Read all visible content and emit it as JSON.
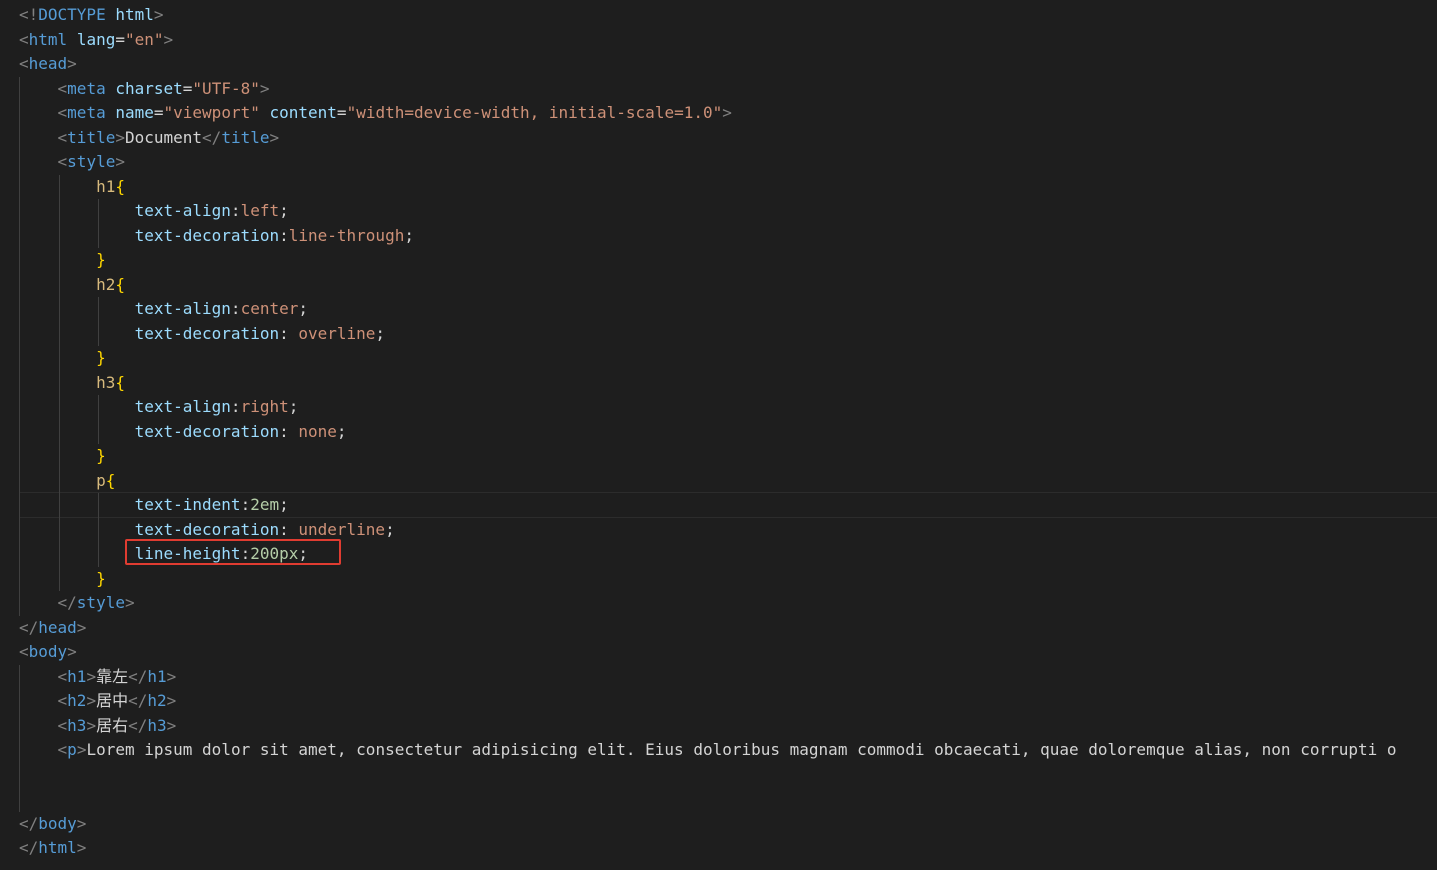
{
  "editor": {
    "theme": {
      "background": "#1e1e1e",
      "tag": "#569cd6",
      "attr": "#9cdcfe",
      "string": "#ce9178",
      "number": "#b5cea8",
      "selector": "#d7ba7d",
      "brace": "#ffd700",
      "punct": "#808080",
      "text": "#d4d4d4",
      "highlight": "#e03c31"
    },
    "lines": [
      [
        {
          "c": "p",
          "v": "<!"
        },
        {
          "c": "t",
          "v": "DOCTYPE"
        },
        {
          "c": "x",
          "v": " "
        },
        {
          "c": "a",
          "v": "html"
        },
        {
          "c": "p",
          "v": ">"
        }
      ],
      [
        {
          "c": "p",
          "v": "<"
        },
        {
          "c": "t",
          "v": "html"
        },
        {
          "c": "x",
          "v": " "
        },
        {
          "c": "a",
          "v": "lang"
        },
        {
          "c": "x",
          "v": "="
        },
        {
          "c": "s",
          "v": "\"en\""
        },
        {
          "c": "p",
          "v": ">"
        }
      ],
      [
        {
          "c": "p",
          "v": "<"
        },
        {
          "c": "t",
          "v": "head"
        },
        {
          "c": "p",
          "v": ">"
        }
      ],
      [
        {
          "c": "x",
          "v": "    "
        },
        {
          "c": "p",
          "v": "<"
        },
        {
          "c": "t",
          "v": "meta"
        },
        {
          "c": "x",
          "v": " "
        },
        {
          "c": "a",
          "v": "charset"
        },
        {
          "c": "x",
          "v": "="
        },
        {
          "c": "s",
          "v": "\"UTF-8\""
        },
        {
          "c": "p",
          "v": ">"
        }
      ],
      [
        {
          "c": "x",
          "v": "    "
        },
        {
          "c": "p",
          "v": "<"
        },
        {
          "c": "t",
          "v": "meta"
        },
        {
          "c": "x",
          "v": " "
        },
        {
          "c": "a",
          "v": "name"
        },
        {
          "c": "x",
          "v": "="
        },
        {
          "c": "s",
          "v": "\"viewport\""
        },
        {
          "c": "x",
          "v": " "
        },
        {
          "c": "a",
          "v": "content"
        },
        {
          "c": "x",
          "v": "="
        },
        {
          "c": "s",
          "v": "\"width=device-width, initial-scale=1.0\""
        },
        {
          "c": "p",
          "v": ">"
        }
      ],
      [
        {
          "c": "x",
          "v": "    "
        },
        {
          "c": "p",
          "v": "<"
        },
        {
          "c": "t",
          "v": "title"
        },
        {
          "c": "p",
          "v": ">"
        },
        {
          "c": "x",
          "v": "Document"
        },
        {
          "c": "p",
          "v": "</"
        },
        {
          "c": "t",
          "v": "title"
        },
        {
          "c": "p",
          "v": ">"
        }
      ],
      [
        {
          "c": "x",
          "v": "    "
        },
        {
          "c": "p",
          "v": "<"
        },
        {
          "c": "t",
          "v": "style"
        },
        {
          "c": "p",
          "v": ">"
        }
      ],
      [
        {
          "c": "x",
          "v": "        "
        },
        {
          "c": "sel",
          "v": "h1"
        },
        {
          "c": "b",
          "v": "{"
        }
      ],
      [
        {
          "c": "x",
          "v": "            "
        },
        {
          "c": "a",
          "v": "text-align"
        },
        {
          "c": "x",
          "v": ":"
        },
        {
          "c": "s",
          "v": "left"
        },
        {
          "c": "x",
          "v": ";"
        }
      ],
      [
        {
          "c": "x",
          "v": "            "
        },
        {
          "c": "a",
          "v": "text-decoration"
        },
        {
          "c": "x",
          "v": ":"
        },
        {
          "c": "s",
          "v": "line-through"
        },
        {
          "c": "x",
          "v": ";"
        }
      ],
      [
        {
          "c": "x",
          "v": "        "
        },
        {
          "c": "b",
          "v": "}"
        }
      ],
      [
        {
          "c": "x",
          "v": "        "
        },
        {
          "c": "sel",
          "v": "h2"
        },
        {
          "c": "b",
          "v": "{"
        }
      ],
      [
        {
          "c": "x",
          "v": "            "
        },
        {
          "c": "a",
          "v": "text-align"
        },
        {
          "c": "x",
          "v": ":"
        },
        {
          "c": "s",
          "v": "center"
        },
        {
          "c": "x",
          "v": ";"
        }
      ],
      [
        {
          "c": "x",
          "v": "            "
        },
        {
          "c": "a",
          "v": "text-decoration"
        },
        {
          "c": "x",
          "v": ": "
        },
        {
          "c": "s",
          "v": "overline"
        },
        {
          "c": "x",
          "v": ";"
        }
      ],
      [
        {
          "c": "x",
          "v": "        "
        },
        {
          "c": "b",
          "v": "}"
        }
      ],
      [
        {
          "c": "x",
          "v": "        "
        },
        {
          "c": "sel",
          "v": "h3"
        },
        {
          "c": "b",
          "v": "{"
        }
      ],
      [
        {
          "c": "x",
          "v": "            "
        },
        {
          "c": "a",
          "v": "text-align"
        },
        {
          "c": "x",
          "v": ":"
        },
        {
          "c": "s",
          "v": "right"
        },
        {
          "c": "x",
          "v": ";"
        }
      ],
      [
        {
          "c": "x",
          "v": "            "
        },
        {
          "c": "a",
          "v": "text-decoration"
        },
        {
          "c": "x",
          "v": ": "
        },
        {
          "c": "s",
          "v": "none"
        },
        {
          "c": "x",
          "v": ";"
        }
      ],
      [
        {
          "c": "x",
          "v": "        "
        },
        {
          "c": "b",
          "v": "}"
        }
      ],
      [
        {
          "c": "x",
          "v": "        "
        },
        {
          "c": "sel",
          "v": "p"
        },
        {
          "c": "b",
          "v": "{"
        }
      ],
      [
        {
          "c": "x",
          "v": "            "
        },
        {
          "c": "a",
          "v": "text-indent"
        },
        {
          "c": "x",
          "v": ":"
        },
        {
          "c": "n",
          "v": "2em"
        },
        {
          "c": "x",
          "v": ";"
        }
      ],
      [
        {
          "c": "x",
          "v": "            "
        },
        {
          "c": "a",
          "v": "text-decoration"
        },
        {
          "c": "x",
          "v": ": "
        },
        {
          "c": "s",
          "v": "underline"
        },
        {
          "c": "x",
          "v": ";"
        }
      ],
      [
        {
          "c": "x",
          "v": "            "
        },
        {
          "c": "a",
          "v": "line-height"
        },
        {
          "c": "x",
          "v": ":"
        },
        {
          "c": "n",
          "v": "200px"
        },
        {
          "c": "x",
          "v": ";"
        }
      ],
      [
        {
          "c": "x",
          "v": "        "
        },
        {
          "c": "b",
          "v": "}"
        }
      ],
      [
        {
          "c": "x",
          "v": "    "
        },
        {
          "c": "p",
          "v": "</"
        },
        {
          "c": "t",
          "v": "style"
        },
        {
          "c": "p",
          "v": ">"
        }
      ],
      [
        {
          "c": "p",
          "v": "</"
        },
        {
          "c": "t",
          "v": "head"
        },
        {
          "c": "p",
          "v": ">"
        }
      ],
      [
        {
          "c": "p",
          "v": "<"
        },
        {
          "c": "t",
          "v": "body"
        },
        {
          "c": "p",
          "v": ">"
        }
      ],
      [
        {
          "c": "x",
          "v": "    "
        },
        {
          "c": "p",
          "v": "<"
        },
        {
          "c": "t",
          "v": "h1"
        },
        {
          "c": "p",
          "v": ">"
        },
        {
          "c": "x",
          "v": "靠左"
        },
        {
          "c": "p",
          "v": "</"
        },
        {
          "c": "t",
          "v": "h1"
        },
        {
          "c": "p",
          "v": ">"
        }
      ],
      [
        {
          "c": "x",
          "v": "    "
        },
        {
          "c": "p",
          "v": "<"
        },
        {
          "c": "t",
          "v": "h2"
        },
        {
          "c": "p",
          "v": ">"
        },
        {
          "c": "x",
          "v": "居中"
        },
        {
          "c": "p",
          "v": "</"
        },
        {
          "c": "t",
          "v": "h2"
        },
        {
          "c": "p",
          "v": ">"
        }
      ],
      [
        {
          "c": "x",
          "v": "    "
        },
        {
          "c": "p",
          "v": "<"
        },
        {
          "c": "t",
          "v": "h3"
        },
        {
          "c": "p",
          "v": ">"
        },
        {
          "c": "x",
          "v": "居右"
        },
        {
          "c": "p",
          "v": "</"
        },
        {
          "c": "t",
          "v": "h3"
        },
        {
          "c": "p",
          "v": ">"
        }
      ],
      [
        {
          "c": "x",
          "v": "    "
        },
        {
          "c": "p",
          "v": "<"
        },
        {
          "c": "t",
          "v": "p"
        },
        {
          "c": "p",
          "v": ">"
        },
        {
          "c": "x",
          "v": "Lorem ipsum dolor sit amet, consectetur adipisicing elit. Eius doloribus magnam commodi obcaecati, quae doloremque alias, non corrupti o"
        }
      ],
      [],
      [],
      [
        {
          "c": "p",
          "v": "</"
        },
        {
          "c": "t",
          "v": "body"
        },
        {
          "c": "p",
          "v": ">"
        }
      ],
      [
        {
          "c": "p",
          "v": "</"
        },
        {
          "c": "t",
          "v": "html"
        },
        {
          "c": "p",
          "v": ">"
        }
      ]
    ]
  }
}
